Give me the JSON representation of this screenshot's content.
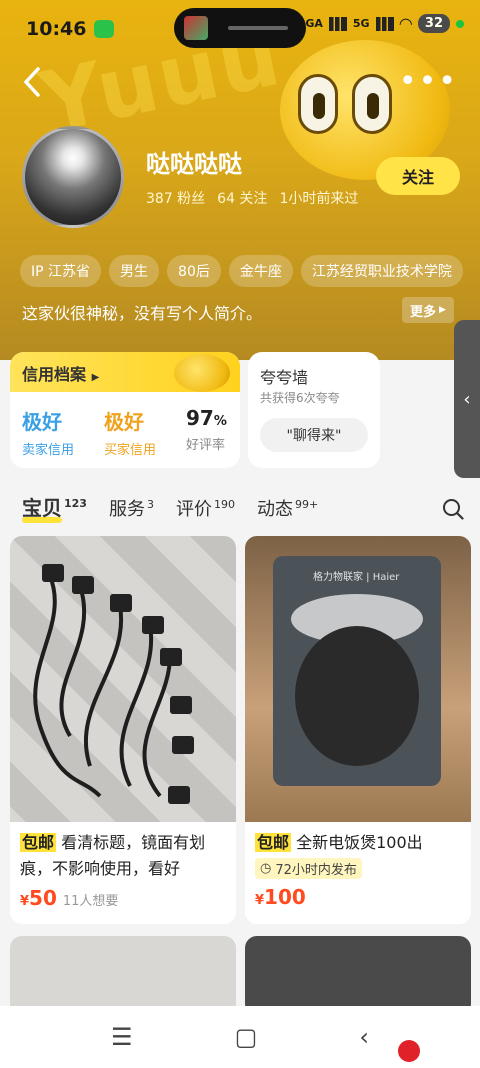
{
  "status_bar": {
    "time": "10:46",
    "network1": "5GA",
    "network2": "5G",
    "battery": "32"
  },
  "header": {
    "back_icon": "chevron-left-icon",
    "more_icon": "more-dots-icon"
  },
  "profile": {
    "name": "哒哒哒哒",
    "fans": "387 粉丝",
    "follows": "64 关注",
    "last_seen": "1小时前来过",
    "follow_label": "关注",
    "tags": [
      "IP 江苏省",
      "男生",
      "80后",
      "金牛座",
      "江苏经贸职业技术学院"
    ],
    "bio": "这家伙很神秘，没有写个人简介。",
    "more_label": "更多"
  },
  "credit": {
    "title": "信用档案",
    "seller": {
      "value": "极好",
      "label": "卖家信用",
      "color": "#3aa0e6"
    },
    "buyer": {
      "value": "极好",
      "label": "买家信用",
      "color": "#f0a21d"
    },
    "rate": {
      "value": "97",
      "unit": "%",
      "label": "好评率"
    }
  },
  "praise_wall": {
    "title": "夸夸墙",
    "subtitle": "共获得6次夸夸",
    "pill": "\"聊得来\""
  },
  "tabs": [
    {
      "label": "宝贝",
      "count": "123"
    },
    {
      "label": "服务",
      "count": "3"
    },
    {
      "label": "评价",
      "count": "190"
    },
    {
      "label": "动态",
      "count": "99+"
    }
  ],
  "items": [
    {
      "badge": "包邮",
      "title": "看清标题，镜面有划痕，不影响使用，看好",
      "currency": "¥",
      "price": "50",
      "wants": "11人想要"
    },
    {
      "badge": "包邮",
      "title": "全新电饭煲100出",
      "tag": "72小时内发布",
      "currency": "¥",
      "price": "100"
    }
  ],
  "cooker_brand": "格力物联家 | Haier",
  "colors": {
    "accent": "#ffe23a",
    "price": "#ff4b1f"
  }
}
